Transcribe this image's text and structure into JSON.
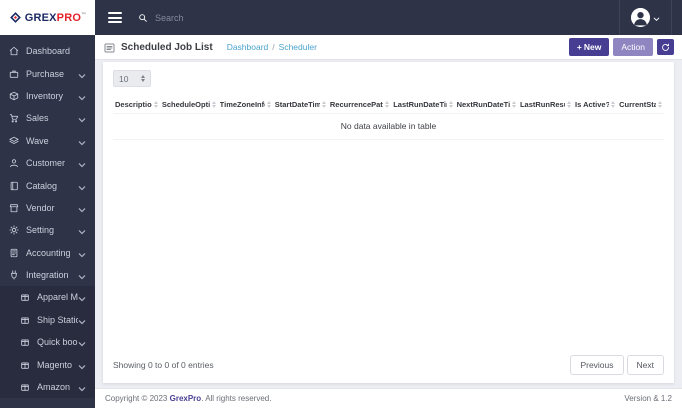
{
  "brand": {
    "grex": "GREX",
    "pro": "PRO",
    "tm": "™"
  },
  "topbar": {
    "search_placeholder": "Search"
  },
  "sidebar": {
    "items": [
      {
        "label": "Dashboard"
      },
      {
        "label": "Purchase"
      },
      {
        "label": "Inventory"
      },
      {
        "label": "Sales"
      },
      {
        "label": "Wave"
      },
      {
        "label": "Customer"
      },
      {
        "label": "Catalog"
      },
      {
        "label": "Vendor"
      },
      {
        "label": "Setting"
      },
      {
        "label": "Accounting"
      },
      {
        "label": "Integration"
      },
      {
        "label": "Apparel Magic"
      },
      {
        "label": "Ship Station"
      },
      {
        "label": "Quick book"
      },
      {
        "label": "Magento"
      },
      {
        "label": "Amazon"
      }
    ]
  },
  "page": {
    "title": "Scheduled Job List",
    "breadcrumb": {
      "home": "Dashboard",
      "separator": "/",
      "current": "Scheduler"
    }
  },
  "toolbar": {
    "new_plus": "+",
    "new_label": "New",
    "action_label": "Action"
  },
  "table": {
    "page_size": "10",
    "columns": [
      "Description",
      "ScheduleOption",
      "TimeZoneInfo",
      "StartDateTime",
      "RecurrencePattern",
      "LastRunDateTime",
      "NextRunDateTime",
      "LastRunResult",
      "Is Active?",
      "CurrentStatus"
    ],
    "empty_text": "No data available in table",
    "info_text": "Showing 0 to 0 of 0 entries",
    "pagination": {
      "previous": "Previous",
      "next": "Next"
    }
  },
  "footer": {
    "copyright": "Copyright © 2023 ",
    "brand": "GrexPro",
    "rights": ". All rights reserved.",
    "version": "Version & 1.2"
  },
  "colors": {
    "sidebar_bg": "#2e3347",
    "submenu_bg": "#282c3e",
    "accent_purple": "#473e93",
    "action_purple": "#8e85c1",
    "link_blue": "#4aa3cc",
    "brand_navy": "#1b2a63",
    "brand_red": "#e52329",
    "content_bg": "#edeef3"
  }
}
